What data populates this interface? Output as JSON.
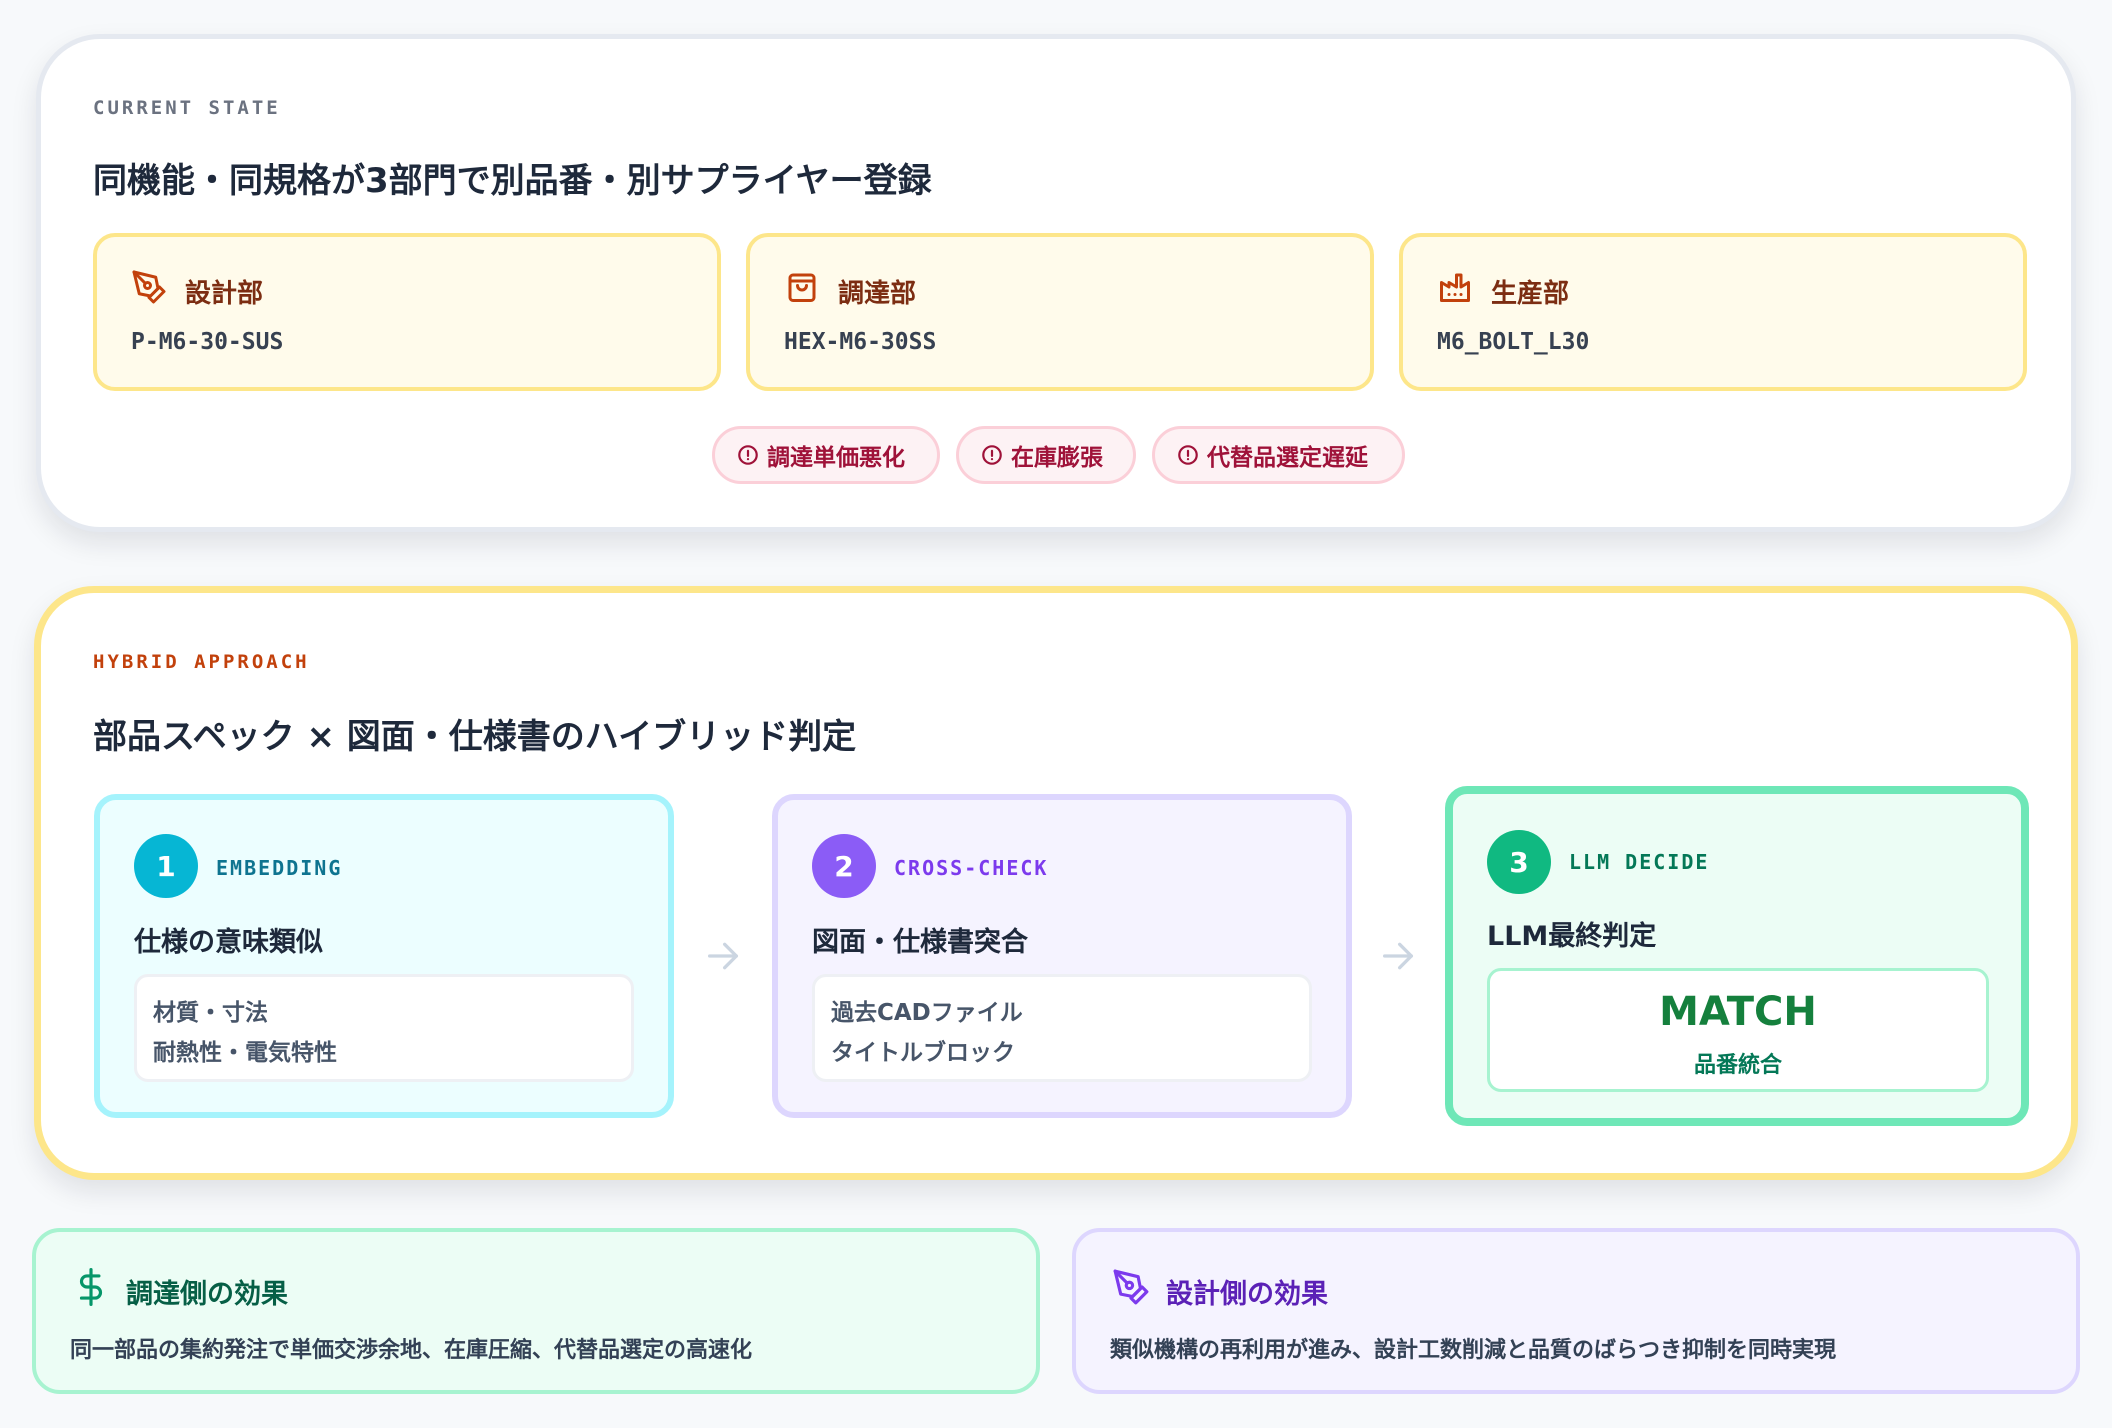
{
  "current_state": {
    "eyebrow": "CURRENT STATE",
    "headline": "同機能・同規格が3部門で別品番・別サプライヤー登録",
    "departments": [
      {
        "name": "設計部",
        "code": "P-M6-30-SUS",
        "icon": "pen-tool-icon"
      },
      {
        "name": "調達部",
        "code": "HEX-M6-30SS",
        "icon": "shopping-bag-icon"
      },
      {
        "name": "生産部",
        "code": "M6_BOLT_L30",
        "icon": "factory-icon"
      }
    ],
    "issues": [
      "調達単価悪化",
      "在庫膨張",
      "代替品選定遅延"
    ]
  },
  "hybrid": {
    "eyebrow": "HYBRID APPROACH",
    "headline": "部品スペック × 図面・仕様書のハイブリッド判定",
    "steps": [
      {
        "number": "1",
        "label": "EMBEDDING",
        "title": "仕様の意味類似",
        "lines": [
          "材質・寸法",
          "耐熱性・電気特性"
        ]
      },
      {
        "number": "2",
        "label": "CROSS-CHECK",
        "title": "図面・仕様書突合",
        "lines": [
          "過去CADファイル",
          "タイトルブロック"
        ]
      },
      {
        "number": "3",
        "label": "LLM DECIDE",
        "title": "LLM最終判定",
        "result": "MATCH",
        "result_sub": "品番統合"
      }
    ]
  },
  "effects": [
    {
      "title": "調達側の効果",
      "text": "同一部品の集約発注で単価交渉余地、在庫圧縮、代替品選定の高速化",
      "icon": "dollar-icon"
    },
    {
      "title": "設計側の効果",
      "text": "類似機構の再利用が進み、設計工数削減と品質のばらつき抑制を同時実現",
      "icon": "pen-tool-icon"
    }
  ],
  "colors": {
    "amber_border": "#fde68a",
    "cyan": "#06b6d4",
    "violet": "#8b5cf6",
    "emerald": "#10b981",
    "alert": "#9f1239"
  }
}
